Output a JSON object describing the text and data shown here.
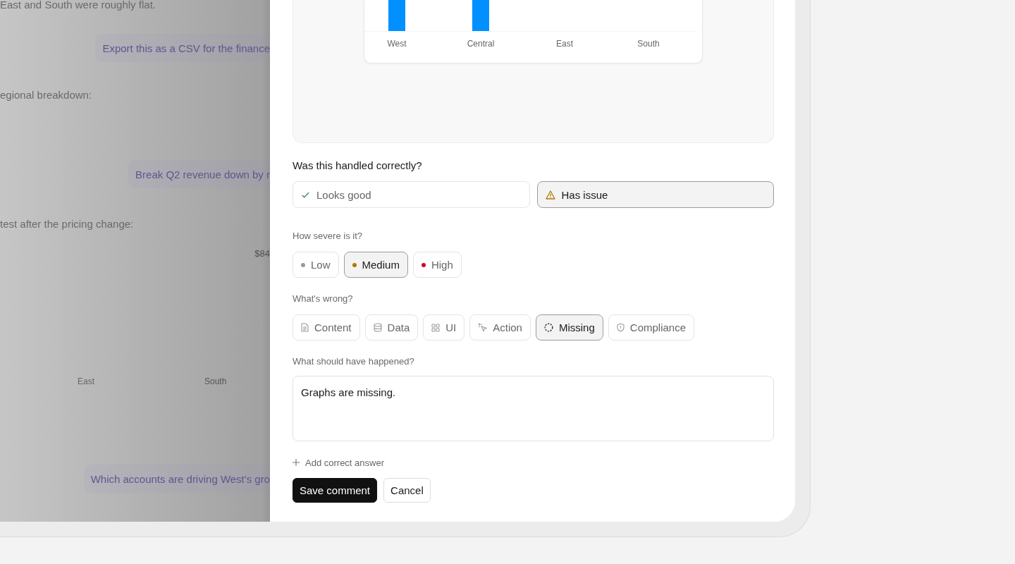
{
  "chat_backdrop": {
    "messages": [
      {
        "kind": "assistant",
        "text": "East and South were roughly flat."
      },
      {
        "kind": "user",
        "text": "Export this as a CSV for the finance"
      },
      {
        "kind": "assistant",
        "text": "egional breakdown:"
      },
      {
        "kind": "user",
        "text": "Break Q2 revenue down by r"
      },
      {
        "kind": "assistant",
        "text": "test after the pricing change:"
      },
      {
        "kind": "value",
        "text": "$84"
      },
      {
        "kind": "axis",
        "labels": [
          "East",
          "South"
        ]
      },
      {
        "kind": "user",
        "text": "Which accounts are driving West's gro"
      }
    ]
  },
  "review_panel": {
    "result_chart": {
      "categories": [
        {
          "label": "West",
          "bar": true
        },
        {
          "label": "Central",
          "bar": true
        },
        {
          "label": "East",
          "bar": false
        },
        {
          "label": "South",
          "bar": false
        }
      ]
    },
    "verdict": {
      "question": "Was this handled correctly?",
      "options": [
        {
          "kind": "good",
          "label": "Looks good",
          "selected": false
        },
        {
          "kind": "issue",
          "label": "Has issue",
          "selected": true
        }
      ]
    },
    "severity": {
      "question": "How severe is it?",
      "options": [
        {
          "label": "Low",
          "color": "#9a9a9a",
          "selected": false
        },
        {
          "label": "Medium",
          "color": "#b07a00",
          "selected": true
        },
        {
          "label": "High",
          "color": "#d6002a",
          "selected": false
        }
      ]
    },
    "problem": {
      "question": "What's wrong?",
      "options": [
        {
          "kind": "content",
          "label": "Content",
          "selected": false
        },
        {
          "kind": "data",
          "label": "Data",
          "selected": false
        },
        {
          "kind": "ui",
          "label": "UI",
          "selected": false
        },
        {
          "kind": "action",
          "label": "Action",
          "selected": false
        },
        {
          "kind": "missing",
          "label": "Missing",
          "selected": true
        },
        {
          "kind": "compliance",
          "label": "Compliance",
          "selected": false
        }
      ]
    },
    "expected": {
      "question": "What should have happened?",
      "value": "Graphs are missing."
    },
    "add_link": "Add correct answer",
    "buttons": [
      {
        "kind": "primary",
        "label": "Save comment"
      },
      {
        "kind": "secondary",
        "label": "Cancel"
      }
    ]
  }
}
